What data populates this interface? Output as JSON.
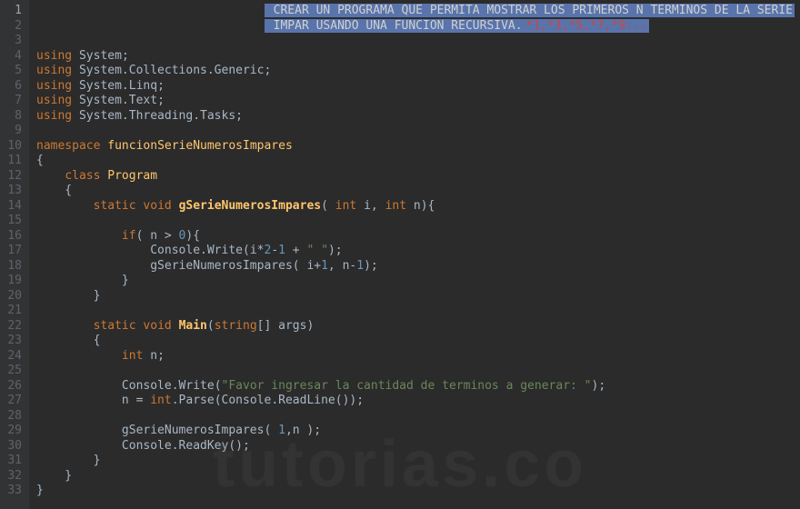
{
  "watermark": "tutorias.co",
  "gutterStart": 1,
  "gutterEnd": 33,
  "currentLine": 1,
  "comment": {
    "line1": " CREAR UN PROGRAMA QUE PERMITA MOSTRAR LOS PRIMEROS N TERMINOS DE LA SERIE",
    "line2_a": " IMPAR USANDO UNA FUNCION RECURSIVA.",
    "line2_b": "*1,*3,*5,*7,*9..."
  },
  "tokens": {
    "using": "using",
    "namespace": "namespace",
    "class": "class",
    "static": "static",
    "void": "void",
    "int": "int",
    "if": "if",
    "System": "System",
    "Collections_Generic": "System.Collections.Generic",
    "Linq": "System.Linq",
    "Text": "System.Text",
    "Threading_Tasks": "System.Threading.Tasks",
    "ns_name": "funcionSerieNumerosImpares",
    "cls_name": "Program",
    "fn_gSerie": "gSerieNumerosImpares",
    "fn_Main": "Main",
    "string_arr": "string",
    "args": "args",
    "i": "i",
    "n": "n",
    "zero": "0",
    "one": "1",
    "two": "2",
    "Console": "Console",
    "Write": "Write",
    "ReadLine": "ReadLine",
    "ReadKey": "ReadKey",
    "Parse": "Parse",
    "str_space": "\" \"",
    "str_prompt": "\"Favor ingresar la cantidad de terminos a generar: \""
  }
}
